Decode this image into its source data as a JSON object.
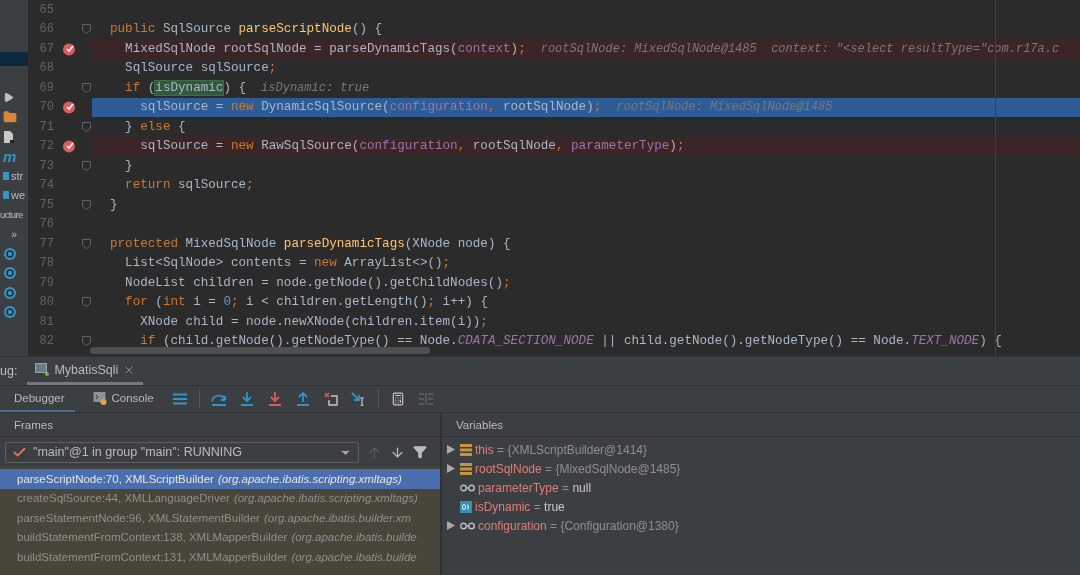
{
  "project_strip": {
    "items": [
      {
        "kind": "play"
      },
      {
        "kind": "folder"
      },
      {
        "kind": "file"
      },
      {
        "kind": "logo",
        "text": "m"
      },
      {
        "kind": "item",
        "text": "str"
      },
      {
        "kind": "item",
        "text": "we"
      },
      {
        "kind": "label",
        "text": "ucture"
      },
      {
        "kind": "more",
        "text": "»"
      },
      {
        "kind": "class"
      },
      {
        "kind": "class"
      },
      {
        "kind": "class"
      },
      {
        "kind": "class"
      }
    ]
  },
  "editor": {
    "lines": [
      {
        "number": "65",
        "breakpoint": false,
        "fold": false,
        "current": false
      },
      {
        "number": "66",
        "breakpoint": false,
        "fold": true,
        "current": false,
        "tokens": [
          {
            "text": "public",
            "kind": "keyword"
          },
          {
            "text": " SqlSource ",
            "kind": "plain"
          },
          {
            "text": "parseScriptNode",
            "kind": "method"
          },
          {
            "text": "() {",
            "kind": "plain"
          }
        ]
      },
      {
        "number": "67",
        "breakpoint": true,
        "fold": false,
        "current": false,
        "tokens": [
          {
            "text": "  MixedSqlNode rootSqlNode = parseDynamicTags(",
            "kind": "plain"
          },
          {
            "text": "context",
            "kind": "field"
          },
          {
            "text": ")",
            "kind": "plain"
          },
          {
            "text": ";",
            "kind": "keyword"
          }
        ],
        "hint": "rootSqlNode: MixedSqlNode@1485  context: \"<select resultType=\"com.r17a.c"
      },
      {
        "number": "68",
        "breakpoint": false,
        "fold": false,
        "current": false,
        "tokens": [
          {
            "text": "  SqlSource sqlSource",
            "kind": "plain"
          },
          {
            "text": ";",
            "kind": "keyword"
          }
        ]
      },
      {
        "number": "69",
        "breakpoint": false,
        "fold": true,
        "current": false,
        "tokens": [
          {
            "text": "  if",
            "kind": "keyword"
          },
          {
            "text": " (",
            "kind": "plain"
          },
          {
            "text": "isDynamic",
            "kind": "match"
          },
          {
            "text": ") {",
            "kind": "plain"
          }
        ],
        "hint": "isDynamic: true"
      },
      {
        "number": "70",
        "breakpoint": true,
        "fold": false,
        "current": true,
        "tokens": [
          {
            "text": "    sqlSource = ",
            "kind": "plain"
          },
          {
            "text": "new",
            "kind": "keyword"
          },
          {
            "text": " DynamicSqlSource(",
            "kind": "plain"
          },
          {
            "text": "configuration",
            "kind": "field"
          },
          {
            "text": ", ",
            "kind": "keyword"
          },
          {
            "text": "rootSqlNode)",
            "kind": "plain"
          },
          {
            "text": ";",
            "kind": "keyword"
          }
        ],
        "hint": "rootSqlNode: MixedSqlNode@1485"
      },
      {
        "number": "71",
        "breakpoint": false,
        "fold": true,
        "current": false,
        "tokens": [
          {
            "text": "  } ",
            "kind": "plain"
          },
          {
            "text": "else",
            "kind": "keyword"
          },
          {
            "text": " {",
            "kind": "plain"
          }
        ]
      },
      {
        "number": "72",
        "breakpoint": true,
        "fold": false,
        "current": false,
        "tokens": [
          {
            "text": "    sqlSource = ",
            "kind": "plain"
          },
          {
            "text": "new",
            "kind": "keyword"
          },
          {
            "text": " RawSqlSource(",
            "kind": "plain"
          },
          {
            "text": "configuration",
            "kind": "field"
          },
          {
            "text": ", ",
            "kind": "keyword"
          },
          {
            "text": "rootSqlNode",
            "kind": "plain"
          },
          {
            "text": ", ",
            "kind": "keyword"
          },
          {
            "text": "parameterType",
            "kind": "field"
          },
          {
            "text": ")",
            "kind": "plain"
          },
          {
            "text": ";",
            "kind": "keyword"
          }
        ]
      },
      {
        "number": "73",
        "breakpoint": false,
        "fold": true,
        "current": false,
        "tokens": [
          {
            "text": "  }",
            "kind": "plain"
          }
        ]
      },
      {
        "number": "74",
        "breakpoint": false,
        "fold": false,
        "current": false,
        "tokens": [
          {
            "text": "  return",
            "kind": "keyword"
          },
          {
            "text": " sqlSource",
            "kind": "plain"
          },
          {
            "text": ";",
            "kind": "keyword"
          }
        ]
      },
      {
        "number": "75",
        "breakpoint": false,
        "fold": true,
        "current": false,
        "tokens": [
          {
            "text": "}",
            "kind": "plain"
          }
        ]
      },
      {
        "number": "76",
        "breakpoint": false,
        "fold": false,
        "current": false
      },
      {
        "number": "77",
        "breakpoint": false,
        "fold": true,
        "current": false,
        "tokens": [
          {
            "text": "protected",
            "kind": "keyword"
          },
          {
            "text": " MixedSqlNode ",
            "kind": "plain"
          },
          {
            "text": "parseDynamicTags",
            "kind": "method"
          },
          {
            "text": "(XNode node) {",
            "kind": "plain"
          }
        ]
      },
      {
        "number": "78",
        "breakpoint": false,
        "fold": false,
        "current": false,
        "tokens": [
          {
            "text": "  List<SqlNode> contents = ",
            "kind": "plain"
          },
          {
            "text": "new",
            "kind": "keyword"
          },
          {
            "text": " ArrayList<>()",
            "kind": "plain"
          },
          {
            "text": ";",
            "kind": "keyword"
          }
        ]
      },
      {
        "number": "79",
        "breakpoint": false,
        "fold": false,
        "current": false,
        "tokens": [
          {
            "text": "  NodeList children = node.getNode().getChildNodes()",
            "kind": "plain"
          },
          {
            "text": ";",
            "kind": "keyword"
          }
        ]
      },
      {
        "number": "80",
        "breakpoint": false,
        "fold": true,
        "current": false,
        "tokens": [
          {
            "text": "  for",
            "kind": "keyword"
          },
          {
            "text": " (",
            "kind": "plain"
          },
          {
            "text": "int",
            "kind": "keyword"
          },
          {
            "text": " i = ",
            "kind": "plain"
          },
          {
            "text": "0",
            "kind": "number"
          },
          {
            "text": "; ",
            "kind": "keyword"
          },
          {
            "text": "i < children.getLength()",
            "kind": "plain"
          },
          {
            "text": "; ",
            "kind": "keyword"
          },
          {
            "text": "i++) {",
            "kind": "plain"
          }
        ]
      },
      {
        "number": "81",
        "breakpoint": false,
        "fold": false,
        "current": false,
        "tokens": [
          {
            "text": "    XNode child = node.newXNode(children.item(i))",
            "kind": "plain"
          },
          {
            "text": ";",
            "kind": "keyword"
          }
        ]
      },
      {
        "number": "82",
        "breakpoint": false,
        "fold": true,
        "current": false,
        "tokens": [
          {
            "text": "    if",
            "kind": "keyword"
          },
          {
            "text": " (child.getNode().getNodeType() == Node.",
            "kind": "plain"
          },
          {
            "text": "CDATA_SECTION_NODE",
            "kind": "constant"
          },
          {
            "text": " || child.getNode().getNodeType() == Node.",
            "kind": "plain"
          },
          {
            "text": "TEXT_NODE",
            "kind": "constant"
          },
          {
            "text": ") {",
            "kind": "plain"
          }
        ]
      }
    ]
  },
  "debug": {
    "label": "ug:",
    "tabs": [
      {
        "label": "MybatisSqli",
        "selected": true
      }
    ],
    "subtabs": [
      {
        "label": "Debugger",
        "kind": "debugger",
        "selected": true
      },
      {
        "label": "Console",
        "kind": "console",
        "selected": false
      }
    ],
    "frames": {
      "title": "Frames",
      "thread": "\"main\"@1 in group \"main\": RUNNING",
      "items": [
        {
          "method": "parseScriptNode:70, XMLScriptBuilder",
          "package": "(org.apache.ibatis.scripting.xmltags)",
          "selected": true
        },
        {
          "method": "createSqlSource:44, XMLLanguageDriver",
          "package": "(org.apache.ibatis.scripting.xmltags)",
          "selected": false
        },
        {
          "method": "parseStatementNode:96, XMLStatementBuilder",
          "package": "(org.apache.ibatis.builder.xm",
          "selected": false
        },
        {
          "method": "buildStatementFromContext:138, XMLMapperBuilder",
          "package": "(org.apache.ibatis.builde",
          "selected": false
        },
        {
          "method": "buildStatementFromContext:131, XMLMapperBuilder",
          "package": "(org.apache.ibatis.builde",
          "selected": false
        }
      ]
    },
    "variables": {
      "title": "Variables",
      "items": [
        {
          "name": "this",
          "sign": "=",
          "value": "{XMLScriptBuilder@1414}",
          "kind": "object",
          "literal": false,
          "expandable": true
        },
        {
          "name": "rootSqlNode",
          "sign": "=",
          "value": "{MixedSqlNode@1485}",
          "kind": "object",
          "literal": false,
          "expandable": true
        },
        {
          "name": "parameterType",
          "sign": "=",
          "value": "null",
          "kind": "field",
          "literal": true,
          "expandable": false
        },
        {
          "name": "isDynamic",
          "sign": "=",
          "value": "true",
          "kind": "primitive",
          "literal": true,
          "expandable": false
        },
        {
          "name": "configuration",
          "sign": "=",
          "value": "{Configuration@1380}",
          "kind": "field",
          "literal": false,
          "expandable": true
        }
      ]
    }
  }
}
